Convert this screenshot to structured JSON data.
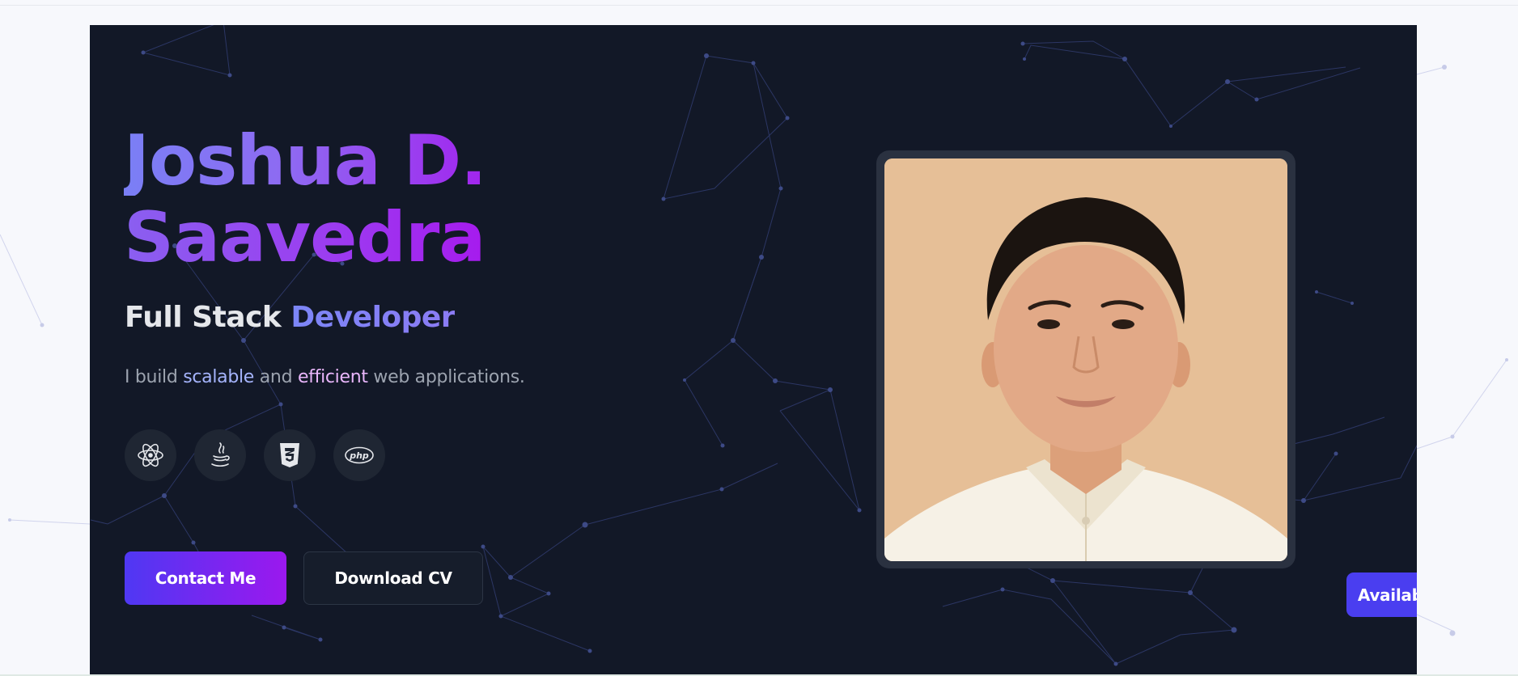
{
  "hero": {
    "name_line1": "Joshua D.",
    "name_line2": "Saavedra",
    "role_prefix": "Full Stack ",
    "role_accent": "Developer",
    "tagline": {
      "part1": "I build ",
      "highlight1": "scalable",
      "part2": " and ",
      "highlight2": "efficient",
      "part3": " web applications."
    },
    "tech_icons": [
      "react-icon",
      "java-icon",
      "css3-icon",
      "php-icon"
    ],
    "buttons": {
      "contact": "Contact Me",
      "download": "Download CV"
    },
    "badge": "Available Now"
  },
  "colors": {
    "hero_bg": "#121827",
    "page_bg": "#f7f8fc",
    "gradient_start": "#7a7ff5",
    "gradient_end": "#a224ee",
    "accent_blue": "#a5b4fc",
    "accent_pink": "#e9b6fb",
    "badge": "#4a3ef0",
    "photo_bg": "#e6bf97"
  }
}
